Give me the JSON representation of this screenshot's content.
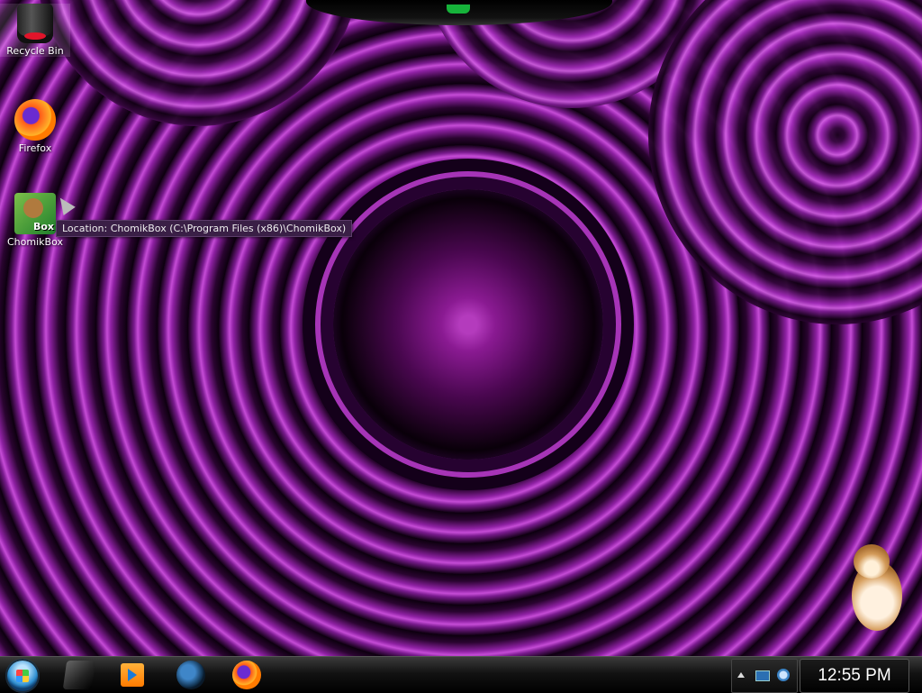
{
  "desktop": {
    "icons": [
      {
        "label": "Recycle Bin",
        "icon": "recycle-bin-icon"
      },
      {
        "label": "Firefox",
        "icon": "firefox-icon"
      },
      {
        "label": "ChomikBox",
        "icon": "chomikbox-icon",
        "badge": "Box"
      }
    ],
    "tooltip": "Location: ChomikBox (C:\\Program Files (x86)\\ChomikBox)"
  },
  "taskbar": {
    "start_icon": "windows-start-orb",
    "pinned": [
      {
        "name": "windows-explorer-icon"
      },
      {
        "name": "media-player-icon"
      },
      {
        "name": "internet-explorer-icon"
      },
      {
        "name": "firefox-icon"
      }
    ],
    "tray_icons": [
      "show-hidden-icons-arrow",
      "network-icon",
      "volume-icon"
    ],
    "clock": "12:55 PM"
  },
  "colors": {
    "wallpaper_primary": "#9b1fa0",
    "wallpaper_dark": "#12000f",
    "taskbar": "#121212",
    "accent_green": "#16b23a"
  }
}
